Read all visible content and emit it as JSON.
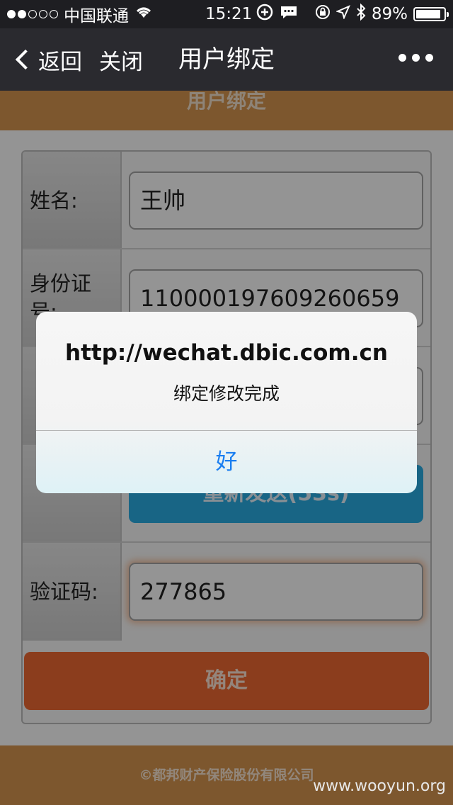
{
  "status_bar": {
    "carrier": "中国联通",
    "time": "15:21",
    "battery": "89%",
    "battery_level": 0.89,
    "signal_bars_filled": 2,
    "signal_bars_total": 5
  },
  "nav": {
    "back_label": "返回",
    "close_label": "关闭",
    "title": "用户绑定"
  },
  "page": {
    "header": "用户绑定",
    "form": {
      "name_label": "姓名:",
      "name_value": "王帅",
      "id_label": "身份证号:",
      "id_value": "110000197609260659",
      "resend_button": "重新发送(53s)",
      "code_label": "验证码:",
      "code_value": "277865",
      "confirm_button": "确定"
    },
    "footer": "©都邦财产保险股份有限公司"
  },
  "alert": {
    "title": "http://wechat.dbic.com.cn",
    "message": "绑定修改完成",
    "ok_button": "好"
  },
  "watermark": "www.wooyun.org"
}
